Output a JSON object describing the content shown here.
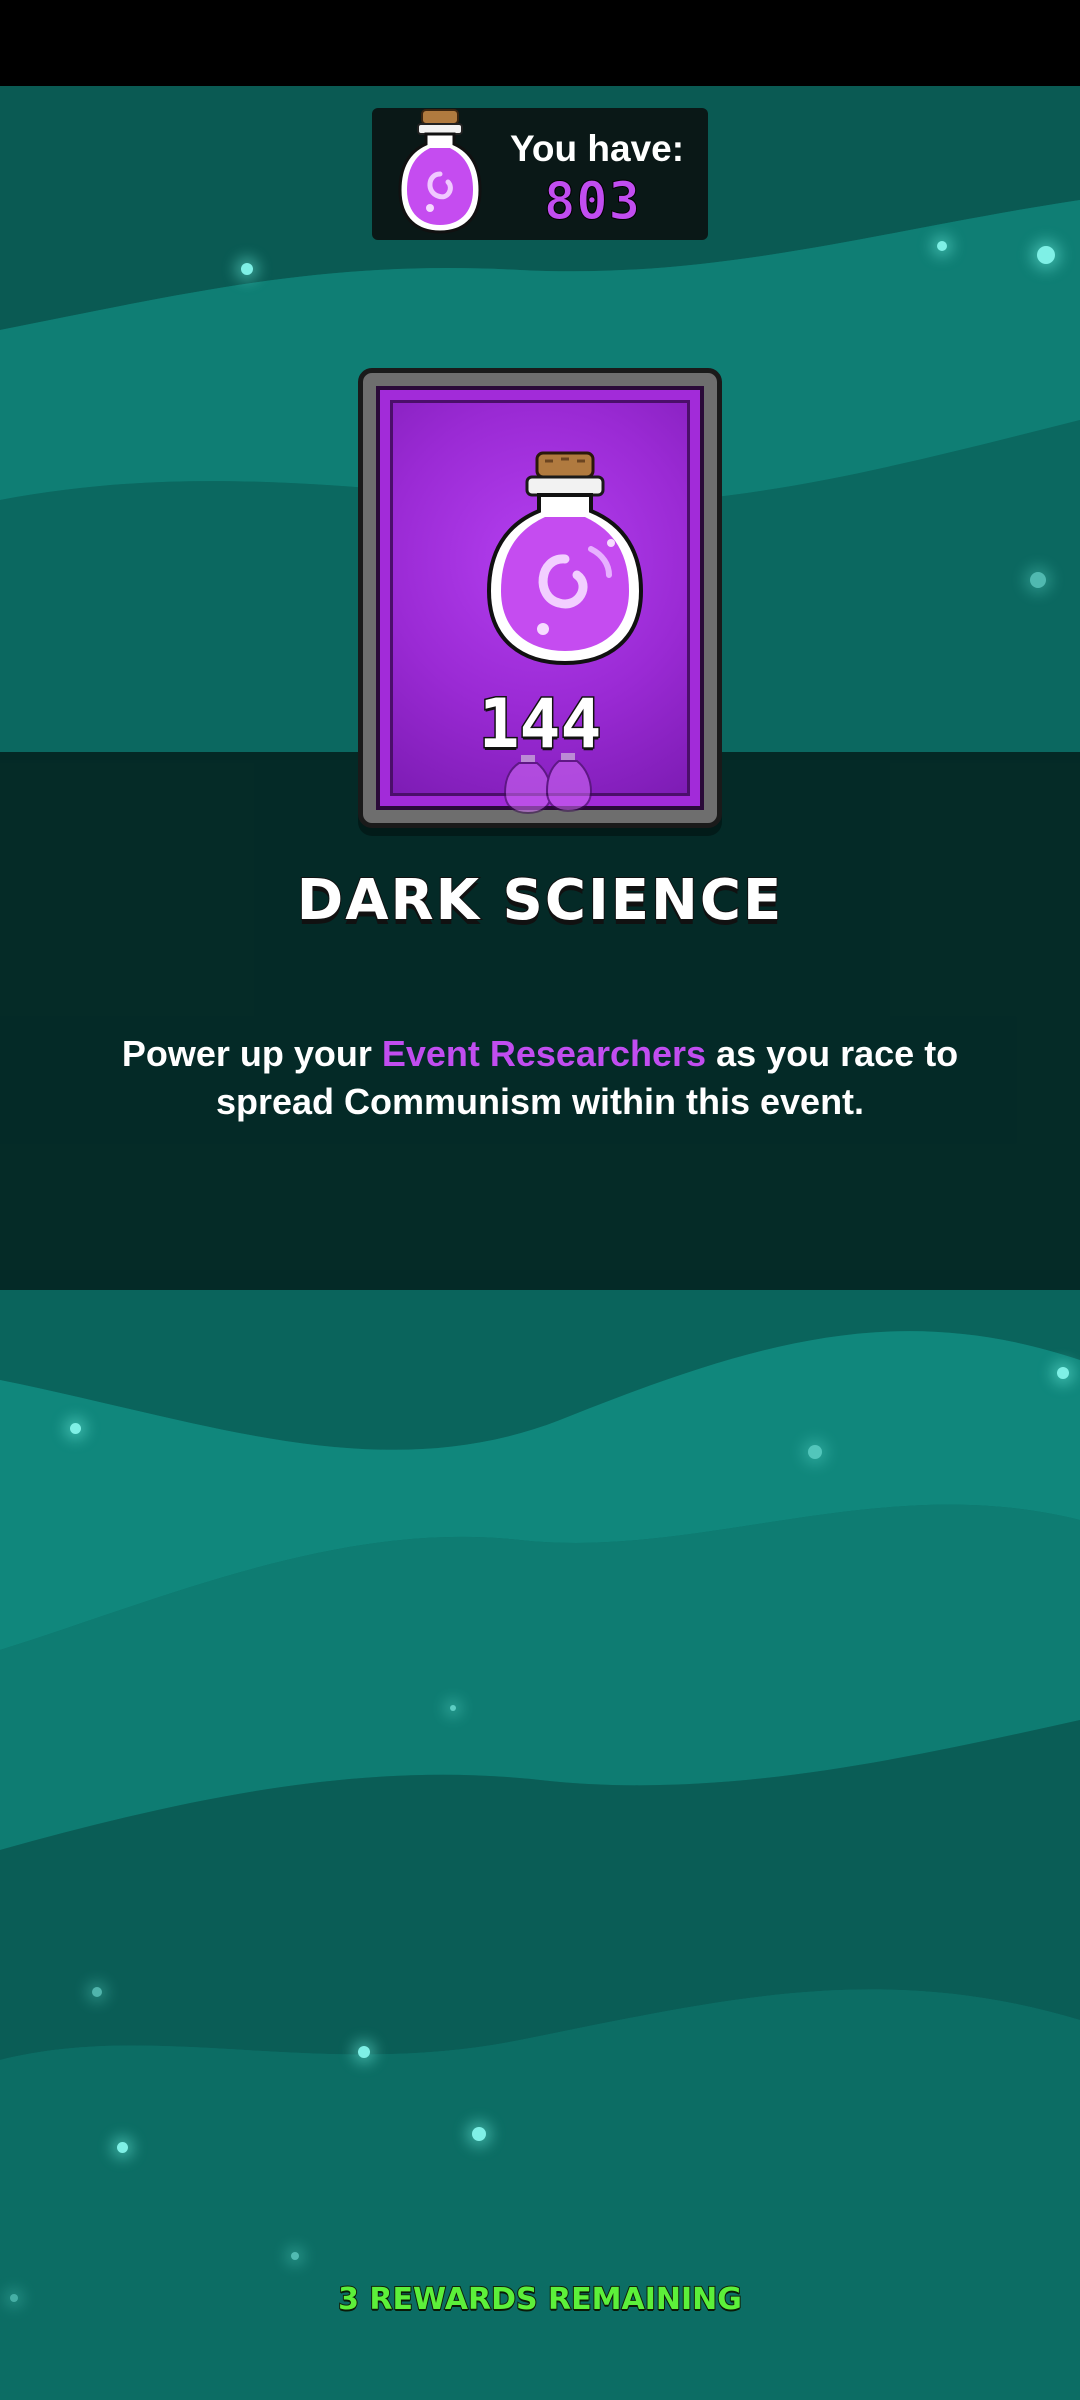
{
  "currency": {
    "label": "You have:",
    "value": "803",
    "icon": "dark-science-potion-icon",
    "value_color": "#c14df0"
  },
  "card": {
    "count": "144",
    "icon": "dark-science-potion-icon",
    "frame_color": "#a22bd9"
  },
  "title": "DARK SCIENCE",
  "description": {
    "before": "Power up your ",
    "highlight": "Event Researchers",
    "after": " as you race to spread Communism within this event.",
    "highlight_color": "#c14df0"
  },
  "footer": {
    "rewards_remaining": "3 REWARDS REMAINING",
    "color": "#5cf03a"
  },
  "colors": {
    "background": "#0c6b63",
    "band": "#031917"
  }
}
